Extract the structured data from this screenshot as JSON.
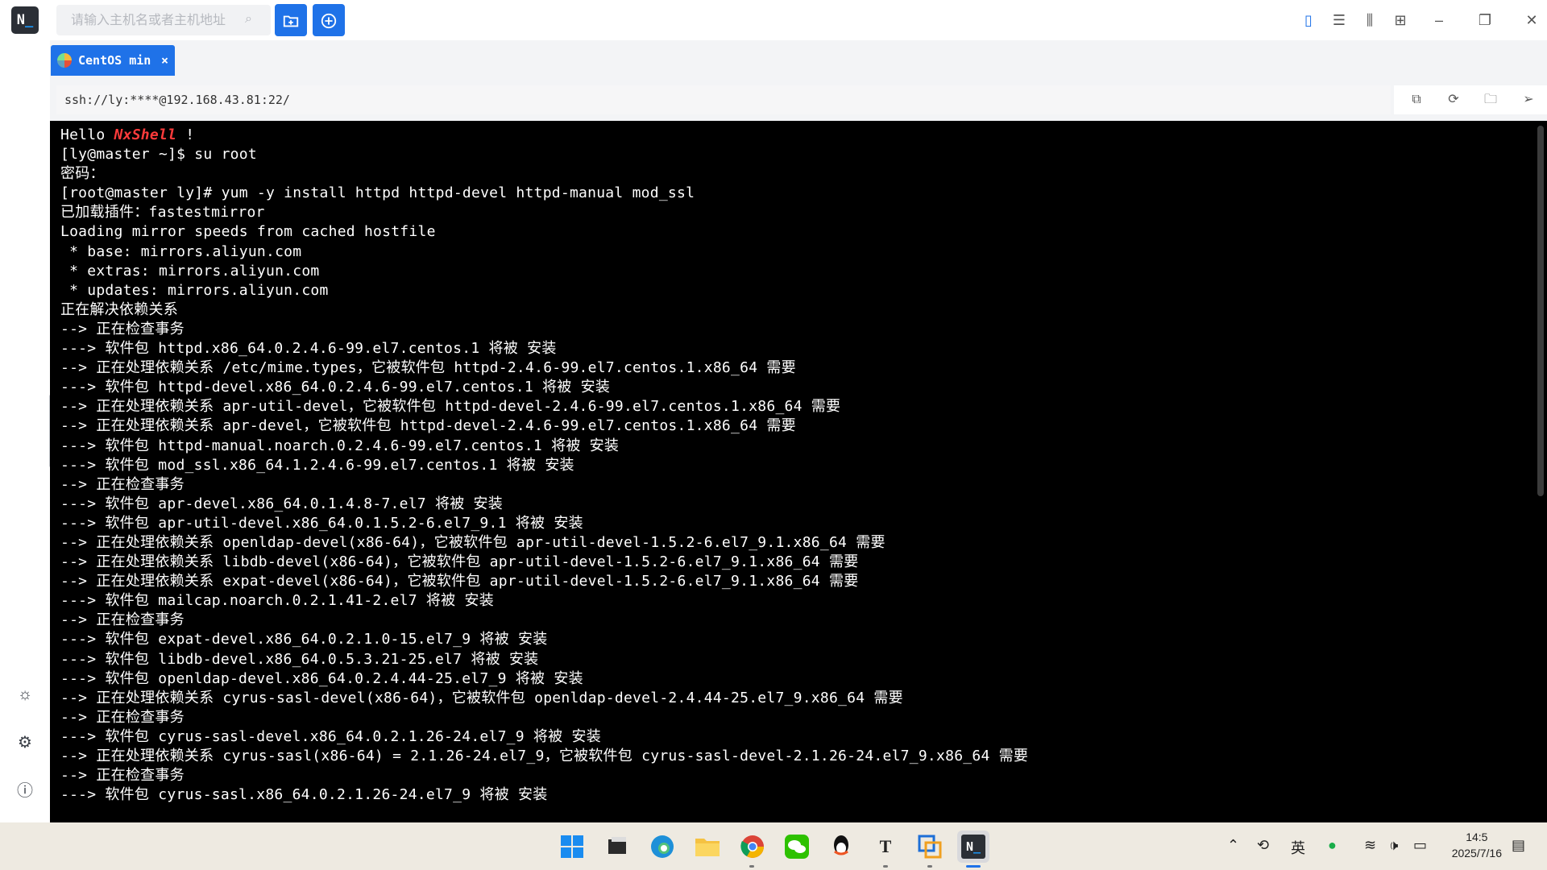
{
  "app": {
    "logo_text": "N",
    "logo_cursor": "_"
  },
  "toolbar": {
    "search_placeholder": "请输入主机名或者主机地址",
    "search_icon": "search-icon",
    "new_folder_icon": "folder-plus-icon",
    "new_session_icon": "plus-circle-icon",
    "view_icons": [
      "single-layout-icon",
      "split-horizontal-icon",
      "split-vertical-icon",
      "grid-layout-icon"
    ],
    "window_icons": [
      "minimize-icon",
      "maximize-icon",
      "close-icon"
    ]
  },
  "tab": {
    "label": "CentOS min",
    "close": "×"
  },
  "address": {
    "url": "ssh://ly:****@192.168.43.81:22/"
  },
  "terminal_lines": [
    {
      "a": "Hello ",
      "b": "NxShell",
      "c": " !"
    },
    {
      "a": "[ly@master ~]$ su root"
    },
    {
      "a": "密码："
    },
    {
      "a": "[root@master ly]# yum -y install httpd httpd-devel httpd-manual mod_ssl"
    },
    {
      "a": "已加载插件：fastestmirror"
    },
    {
      "a": "Loading mirror speeds from cached hostfile"
    },
    {
      "a": " * base: mirrors.aliyun.com"
    },
    {
      "a": " * extras: mirrors.aliyun.com"
    },
    {
      "a": " * updates: mirrors.aliyun.com"
    },
    {
      "a": "正在解决依赖关系"
    },
    {
      "a": "--> 正在检查事务"
    },
    {
      "a": "---> 软件包 httpd.x86_64.0.2.4.6-99.el7.centos.1 将被 安装"
    },
    {
      "a": "--> 正在处理依赖关系 /etc/mime.types，它被软件包 httpd-2.4.6-99.el7.centos.1.x86_64 需要"
    },
    {
      "a": "---> 软件包 httpd-devel.x86_64.0.2.4.6-99.el7.centos.1 将被 安装"
    },
    {
      "a": "--> 正在处理依赖关系 apr-util-devel，它被软件包 httpd-devel-2.4.6-99.el7.centos.1.x86_64 需要"
    },
    {
      "a": "--> 正在处理依赖关系 apr-devel，它被软件包 httpd-devel-2.4.6-99.el7.centos.1.x86_64 需要"
    },
    {
      "a": "---> 软件包 httpd-manual.noarch.0.2.4.6-99.el7.centos.1 将被 安装"
    },
    {
      "a": "---> 软件包 mod_ssl.x86_64.1.2.4.6-99.el7.centos.1 将被 安装"
    },
    {
      "a": "--> 正在检查事务"
    },
    {
      "a": "---> 软件包 apr-devel.x86_64.0.1.4.8-7.el7 将被 安装"
    },
    {
      "a": "---> 软件包 apr-util-devel.x86_64.0.1.5.2-6.el7_9.1 将被 安装"
    },
    {
      "a": "--> 正在处理依赖关系 openldap-devel(x86-64)，它被软件包 apr-util-devel-1.5.2-6.el7_9.1.x86_64 需要"
    },
    {
      "a": "--> 正在处理依赖关系 libdb-devel(x86-64)，它被软件包 apr-util-devel-1.5.2-6.el7_9.1.x86_64 需要"
    },
    {
      "a": "--> 正在处理依赖关系 expat-devel(x86-64)，它被软件包 apr-util-devel-1.5.2-6.el7_9.1.x86_64 需要"
    },
    {
      "a": "---> 软件包 mailcap.noarch.0.2.1.41-2.el7 将被 安装"
    },
    {
      "a": "--> 正在检查事务"
    },
    {
      "a": "---> 软件包 expat-devel.x86_64.0.2.1.0-15.el7_9 将被 安装"
    },
    {
      "a": "---> 软件包 libdb-devel.x86_64.0.5.3.21-25.el7 将被 安装"
    },
    {
      "a": "---> 软件包 openldap-devel.x86_64.0.2.4.44-25.el7_9 将被 安装"
    },
    {
      "a": "--> 正在处理依赖关系 cyrus-sasl-devel(x86-64)，它被软件包 openldap-devel-2.4.44-25.el7_9.x86_64 需要"
    },
    {
      "a": "--> 正在检查事务"
    },
    {
      "a": "---> 软件包 cyrus-sasl-devel.x86_64.0.2.1.26-24.el7_9 将被 安装"
    },
    {
      "a": "--> 正在处理依赖关系 cyrus-sasl(x86-64) = 2.1.26-24.el7_9，它被软件包 cyrus-sasl-devel-2.1.26-24.el7_9.x86_64 需要"
    },
    {
      "a": "--> 正在检查事务"
    },
    {
      "a": "---> 软件包 cyrus-sasl.x86_64.0.2.1.26-24.el7_9 将被 安装"
    }
  ],
  "colors": {
    "accent": "#1f72e8",
    "terminal_bg": "#000000",
    "brand_red": "#ff3b3b"
  },
  "sidebar_icons": [
    "sun-icon",
    "gear-icon",
    "info-icon"
  ],
  "taskbar": {
    "apps": [
      "windows-start-icon",
      "file-manager-icon",
      "edge-icon",
      "folder-icon",
      "chrome-icon",
      "wechat-icon",
      "qq-icon",
      "typora-icon",
      "virtualbox-icon",
      "nxshell-icon"
    ],
    "typora_letter": "T",
    "ime": "英",
    "clock_time": "14:5",
    "clock_date": "2025/7/16"
  }
}
